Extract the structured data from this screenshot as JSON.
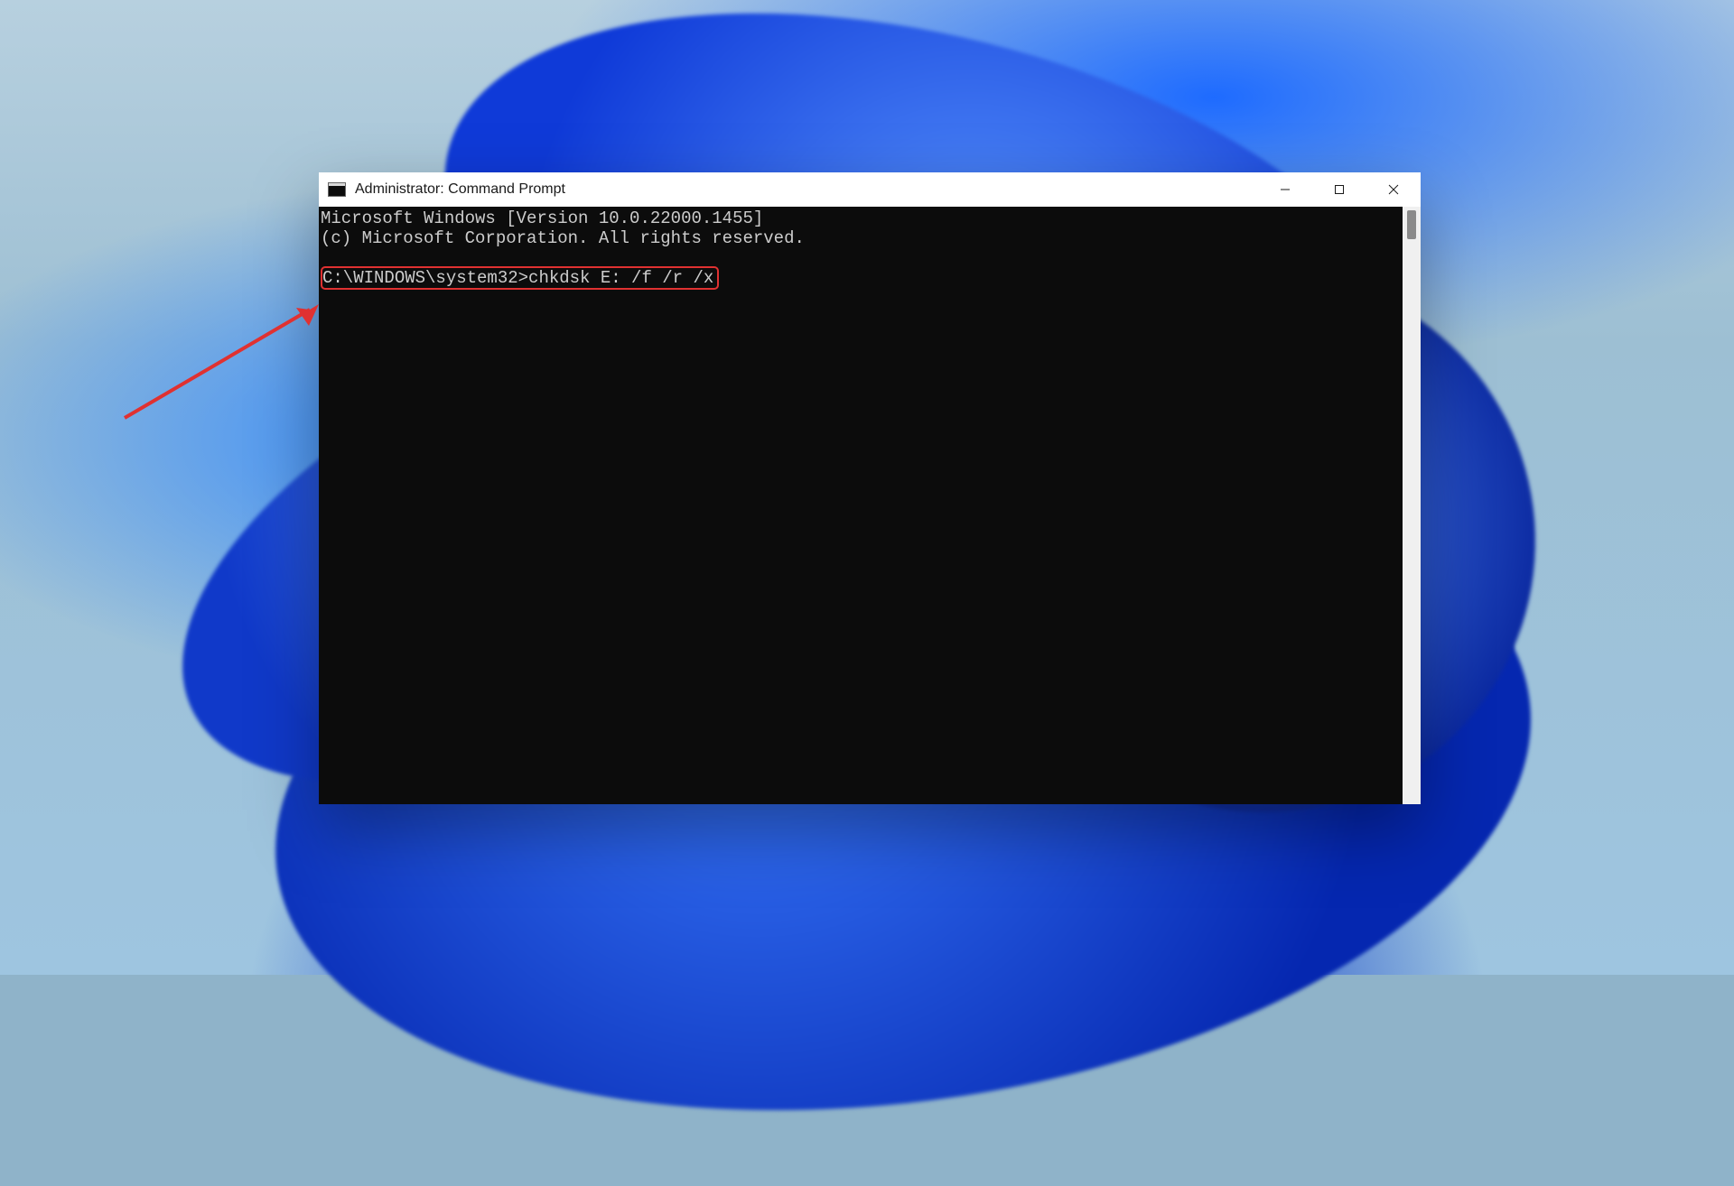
{
  "window": {
    "title": "Administrator: Command Prompt"
  },
  "console": {
    "line1": "Microsoft Windows [Version 10.0.22000.1455]",
    "line2": "(c) Microsoft Corporation. All rights reserved.",
    "prompt_line": "C:\\WINDOWS\\system32>chkdsk E: /f /r /x"
  },
  "annotation": {
    "highlight_color": "#e03131"
  }
}
